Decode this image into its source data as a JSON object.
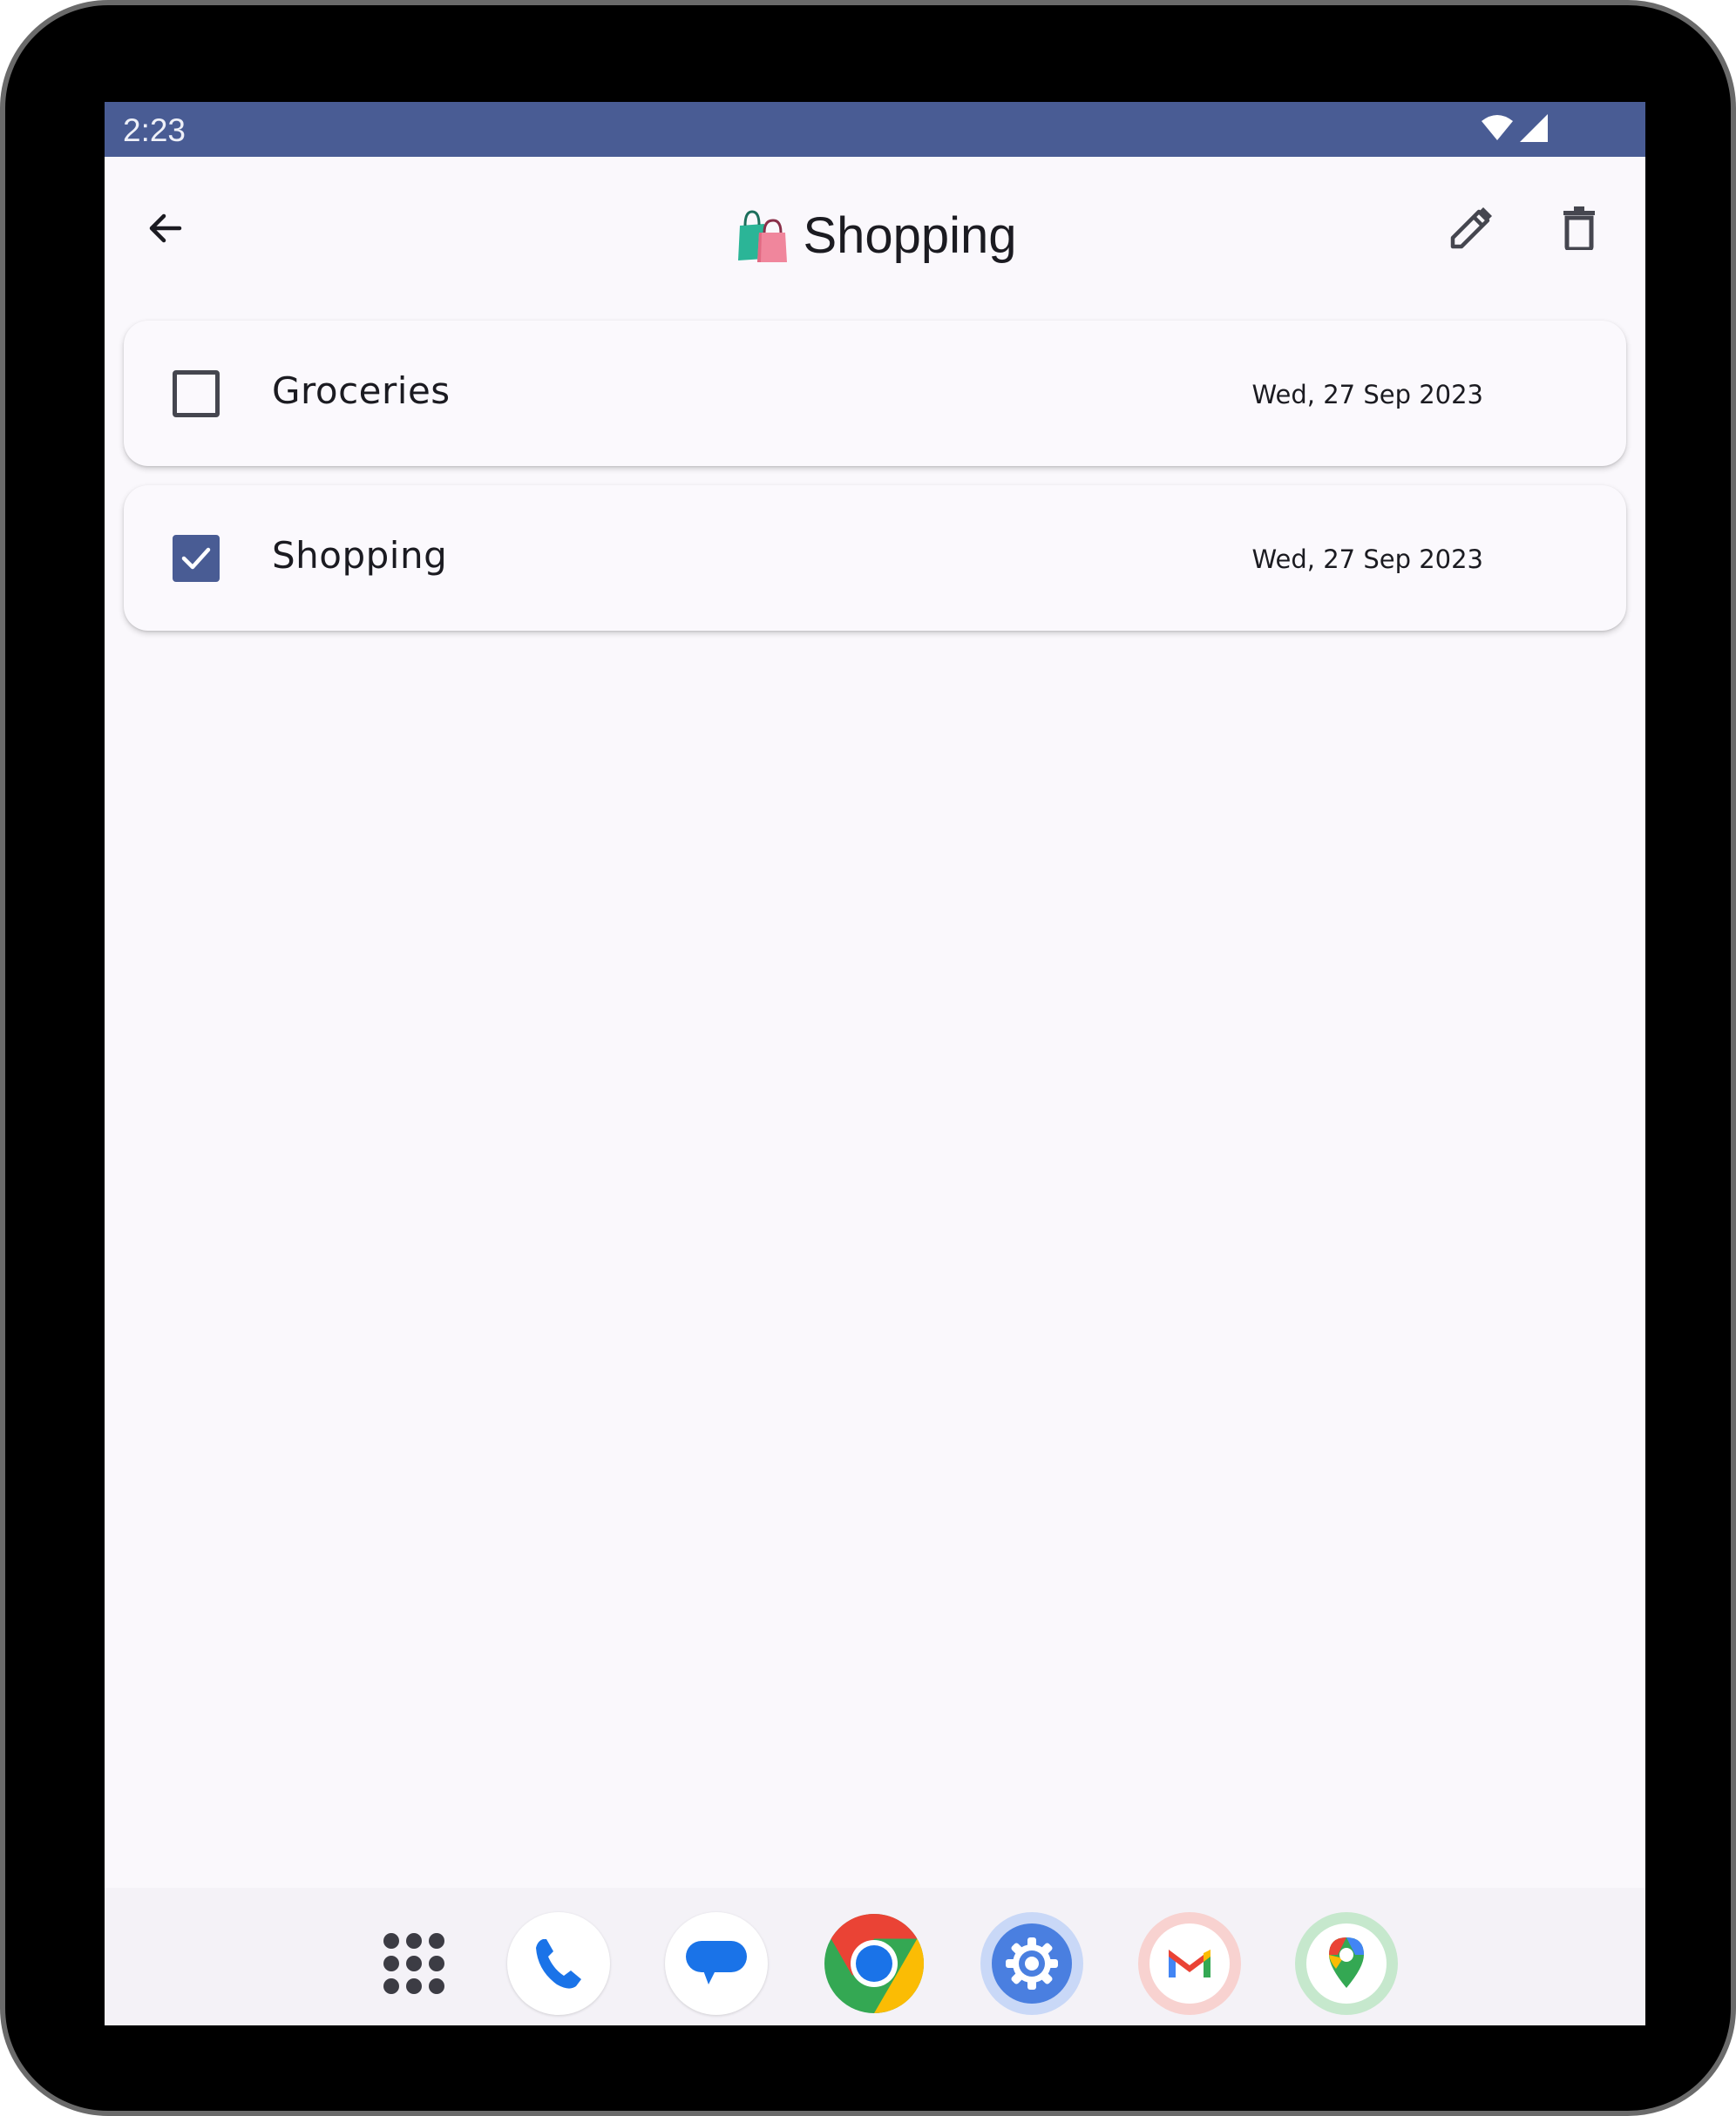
{
  "status_bar": {
    "time": "2:23",
    "icons": [
      "wifi-icon",
      "cellular-signal-icon"
    ]
  },
  "header": {
    "title_emoji": "🛍️",
    "title": "Shopping",
    "actions": [
      "back-arrow-icon",
      "edit-pencil-icon",
      "delete-trash-icon"
    ]
  },
  "items": [
    {
      "label": "Groceries",
      "date": "Wed, 27 Sep 2023",
      "checked": false
    },
    {
      "label": "Shopping",
      "date": "Wed, 27 Sep 2023",
      "checked": true
    }
  ],
  "dock": {
    "apps": [
      "app-drawer",
      "phone",
      "messages",
      "chrome",
      "settings",
      "gmail",
      "maps"
    ]
  },
  "colors": {
    "accent": "#495c94",
    "background": "#faf8fc",
    "text": "#1b1b21",
    "icon": "#45464f"
  }
}
